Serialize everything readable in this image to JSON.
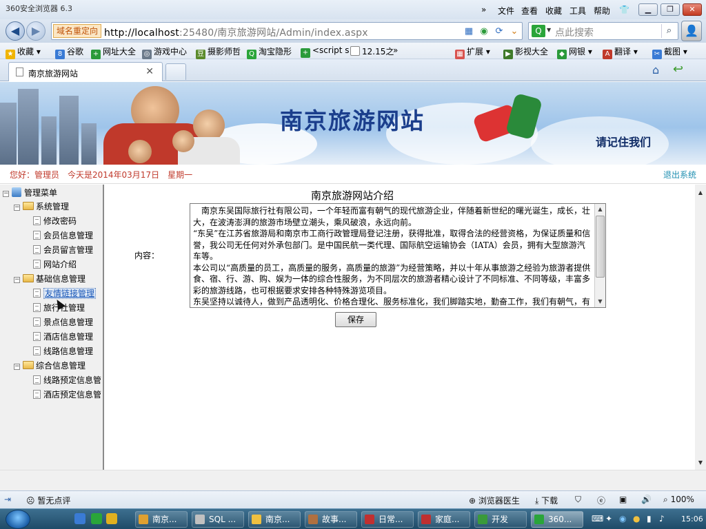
{
  "browser": {
    "title": "360安全浏览器 6.3",
    "menu": [
      "文件",
      "查看",
      "收藏",
      "工具",
      "帮助"
    ],
    "redirect_badge": "域名重定向",
    "url_host": "http://localhost",
    "url_rest": ":25480/南京旅游网站/Admin/index.aspx",
    "search_placeholder": "点此搜索",
    "bookmarks_left": [
      "收藏",
      "谷歌",
      "网址大全",
      "游戏中心",
      "摄影师哲",
      "淘宝隐形",
      "<script s",
      "12.15之"
    ],
    "bookmarks_right": [
      "扩展",
      "影视大全",
      "网银",
      "翻译",
      "截图"
    ],
    "tab_title": "南京旅游网站",
    "overflow_glyph": "»"
  },
  "banner": {
    "title": "南京旅游网站",
    "slogan": "请记住我们"
  },
  "header": {
    "greeting": "您好：管理员　今天是2014年03月17日　星期一",
    "logout": "退出系统"
  },
  "sidebar": {
    "root": "管理菜单",
    "groups": [
      {
        "label": "系统管理",
        "items": [
          "修改密码",
          "会员信息管理",
          "会员留言管理",
          "网站介绍"
        ]
      },
      {
        "label": "基础信息管理",
        "items": [
          "友情链接管理",
          "旅行社管理",
          "景点信息管理",
          "酒店信息管理",
          "线路信息管理"
        ]
      },
      {
        "label": "综合信息管理",
        "items": [
          "线路预定信息管",
          "酒店预定信息管"
        ]
      }
    ]
  },
  "main": {
    "section_title": "南京旅游网站介绍",
    "content_label": "内容：",
    "content_paragraphs": [
      "　南京东吴国际旅行社有限公司，一个年轻而富有朝气的现代旅游企业，伴随着新世纪的曙光诞生，成长，壮大，在波涛澎湃的旅游市场壁立潮头，乘风破浪，永远向前。",
      "“东吴”在江苏省旅游局和南京市工商行政管理局登记注册，获得批准，取得合法的经营资格，为保证质量和信誉，我公司无任何对外承包部门。是中国民航一类代理、国际航空运输协会（IATA）会员，拥有大型旅游汽车等。",
      "本公司以“高质量的员工，高质量的服务，高质量的旅游”为经营策略，并以十年从事旅游之经验为旅游者提供食、宿、行、游、购、娱为一体的综合性服务，为不同层次的旅游者精心设计了不同标准、不同等级，丰富多彩的旅游线路，也可根据要求安排各种特殊游览项目。",
      "东吴坚持以诚待人，做到产品透明化、价格合理化、服务标准化，我们脚踏实地，勤奋工作，我们有朝气，有信心，有实力，立足南京，面向全国，努力创建一个中国旅游品牌——“东吴"
    ],
    "save_label": "保存"
  },
  "statusbar": {
    "left": "暂无点评",
    "doctor": "浏览器医生",
    "download": "下载",
    "zoom": "100%"
  },
  "taskbar": {
    "tasks": [
      "南京...",
      "SQL ...",
      "南京...",
      "故事...",
      "日常...",
      "家庭...",
      "开发",
      "360..."
    ],
    "clock": "15:06"
  }
}
